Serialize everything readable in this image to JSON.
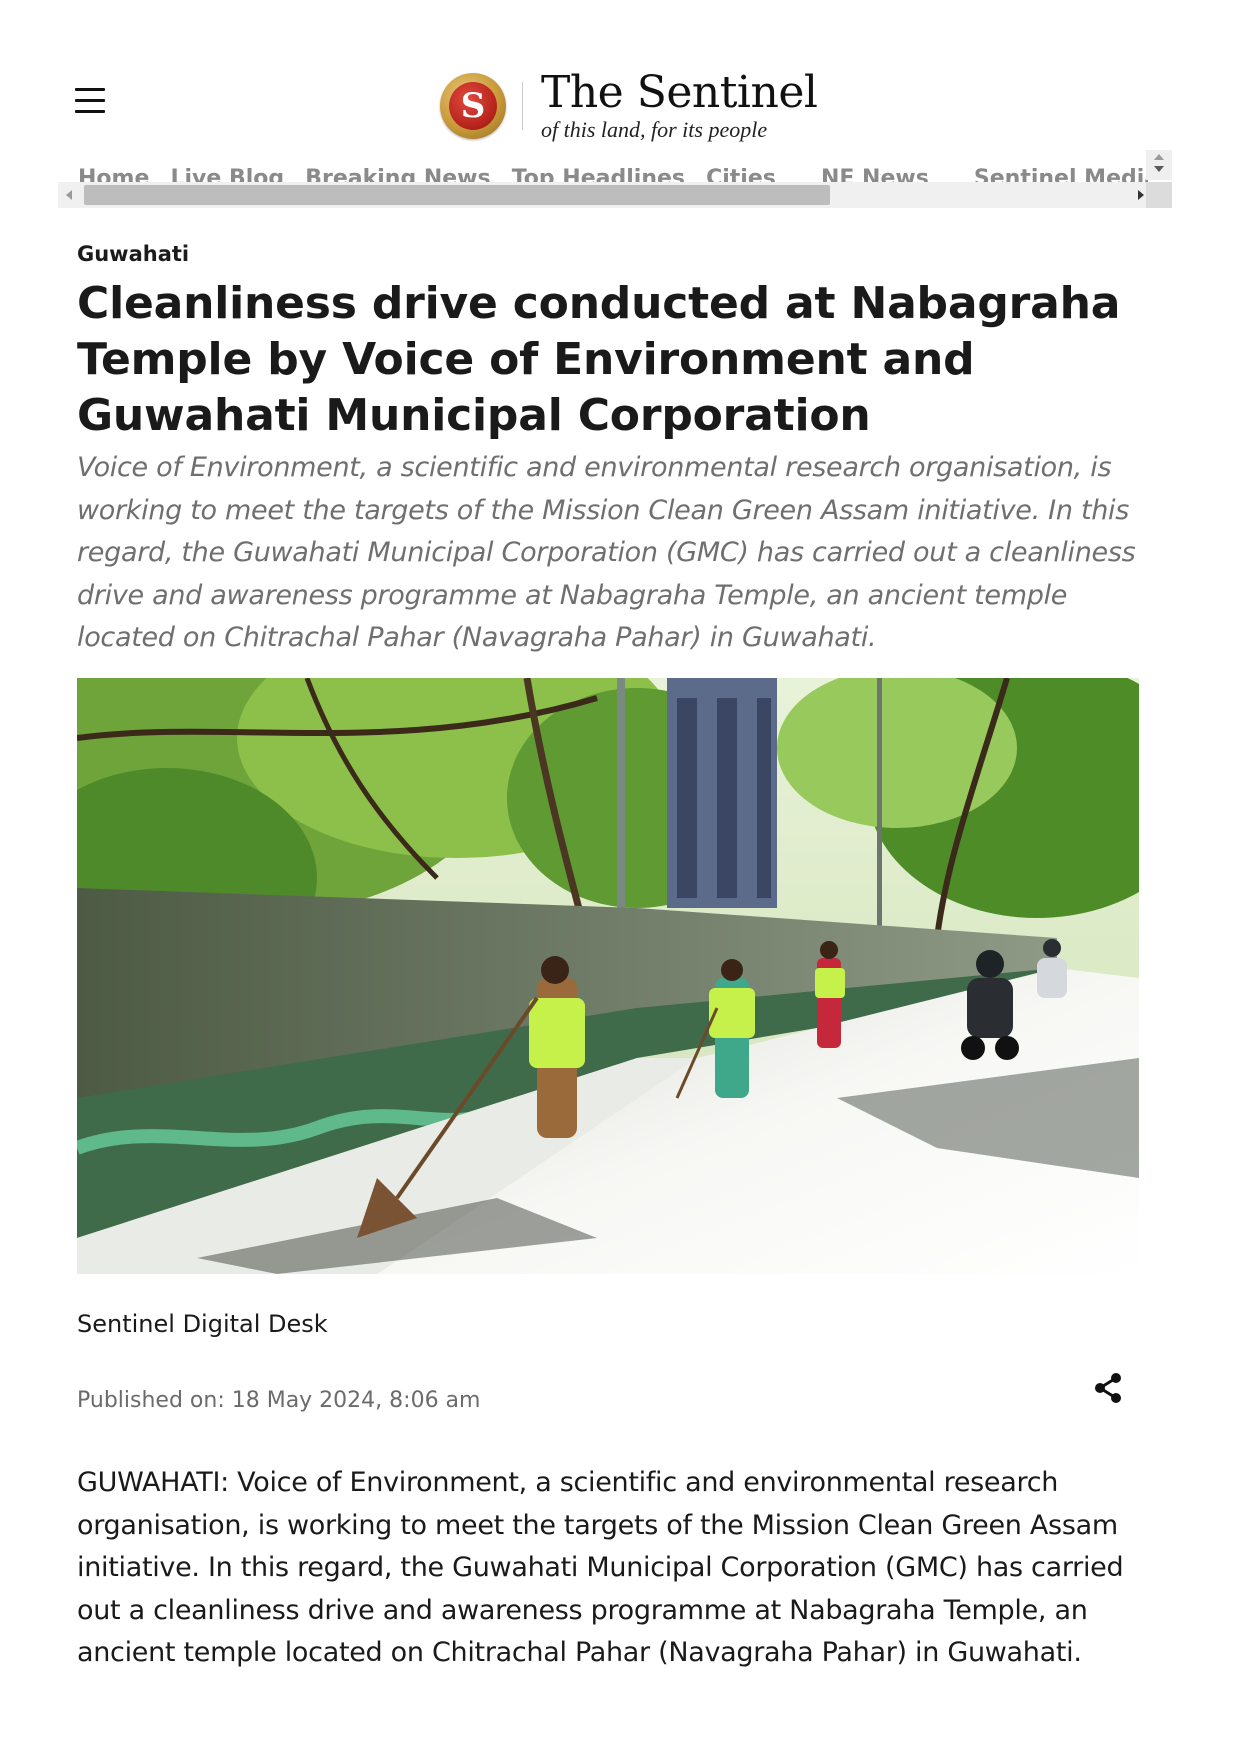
{
  "header": {
    "menu_icon": "hamburger-menu-icon",
    "brand": {
      "logo_letter": "S",
      "name": "The Sentinel",
      "tagline": "of this land, for its people"
    }
  },
  "nav": {
    "items": [
      {
        "label": "Home"
      },
      {
        "label": "Live Blog"
      },
      {
        "label": "Breaking News"
      },
      {
        "label": "Top Headlines"
      },
      {
        "label": "Cities"
      },
      {
        "label": "NE News"
      },
      {
        "label": "Sentinel Media"
      }
    ]
  },
  "article": {
    "section": "Guwahati",
    "headline": "Cleanliness drive conducted at Nabagraha Temple by Voice of Environment and Guwahati Municipal Corporation",
    "standfirst": "Voice of Environment, a scientific and environmental research organisation, is working to meet the targets of the Mission Clean Green Assam initiative. In this regard, the Guwahati Municipal Corporation (GMC) has carried out a cleanliness drive and awareness programme at Nabagraha Temple, an ancient temple located on Chitrachal Pahar (Navagraha Pahar) in Guwahati.",
    "author": "Sentinel Digital Desk",
    "published": "Published on: 18 May 2024, 8:06 am",
    "share_icon": "share-icon",
    "body": "GUWAHATI: Voice of Environment, a scientific and environmental research organisation, is working to meet the targets of the Mission Clean Green Assam initiative. In this regard, the Guwahati Municipal Corporation (GMC) has carried out a cleanliness drive and awareness programme at Nabagraha Temple, an ancient temple located on Chitrachal Pahar (Navagraha Pahar) in Guwahati."
  },
  "colors": {
    "text": "#1a1a1a",
    "muted": "#6f6f6f",
    "nav": "#8a8a8a",
    "brand_red": "#b3221a",
    "brand_gold": "#c99a3a"
  }
}
